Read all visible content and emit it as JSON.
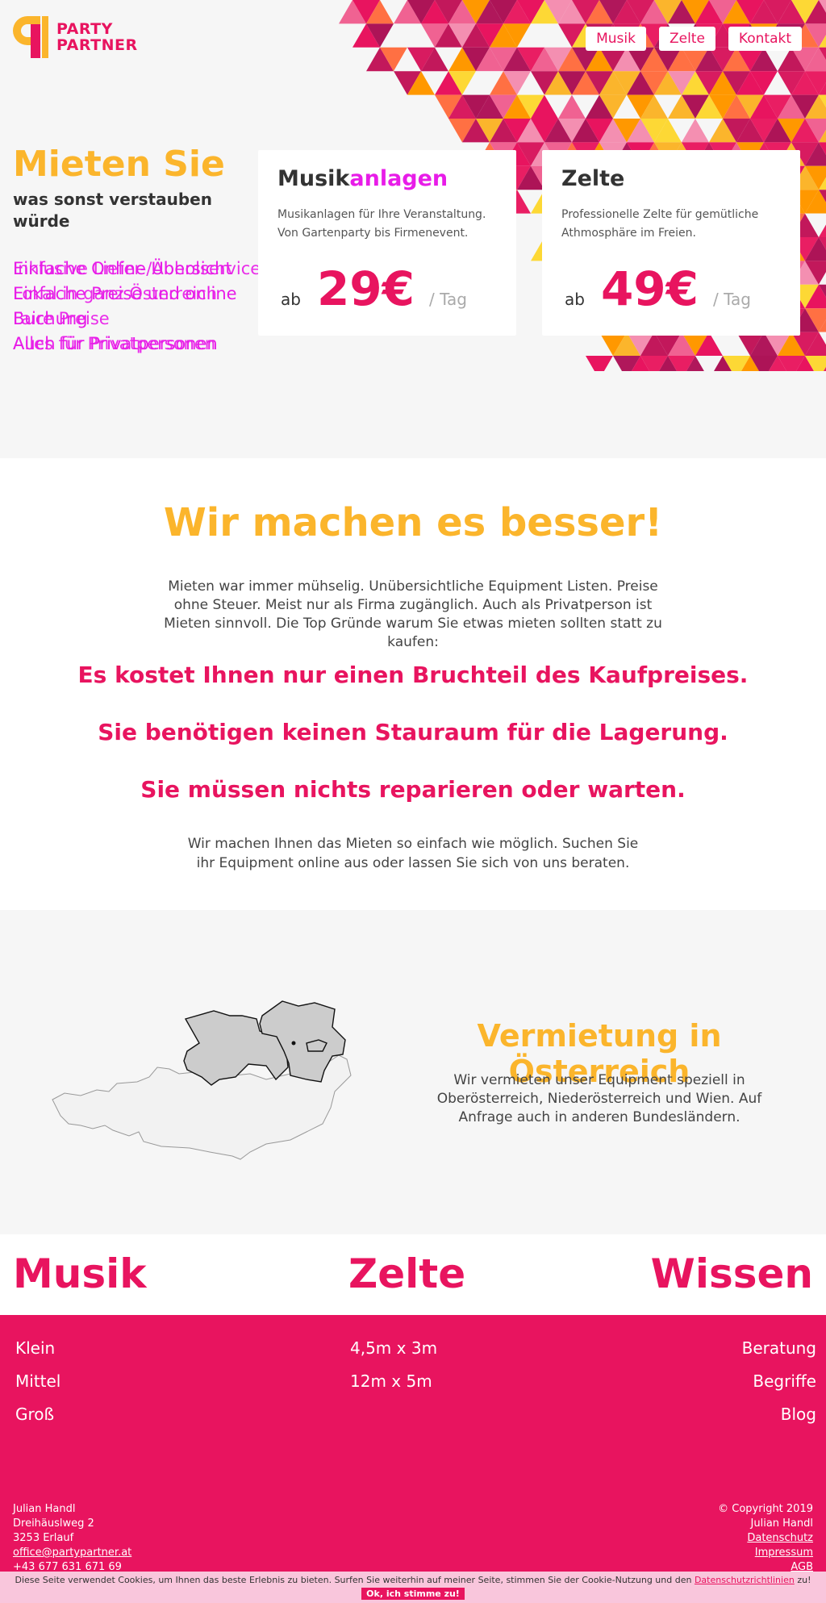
{
  "brand": {
    "line1": "PARTY",
    "line2": "PARTNER",
    "color_primary": "#e8145f",
    "color_accent": "#fbb52c",
    "color_highlight": "#e81ce8"
  },
  "nav": {
    "items": [
      "Musik",
      "Zelte",
      "Kontakt"
    ]
  },
  "hero": {
    "title": "Mieten Sie",
    "subtitle": "was sonst verstauben würde",
    "overlap_a": [
      "Einfache Online Übersicht",
      "Einfache Preise und online",
      "Buchung",
      "Auch für Privatpersonen"
    ],
    "overlap_b": [
      "Inklusive Liefer-/Abholservice",
      "Lokal in ganz Österreich",
      "Faire Preise",
      "Alles für Privatpersonen"
    ]
  },
  "cards": [
    {
      "title_a": "Musik",
      "title_b": "anlagen",
      "desc": "Musikanlagen für Ihre Veranstaltung. Von Gartenparty bis Firmenevent.",
      "price_prefix": "ab",
      "price": "29€",
      "price_unit": "/ Tag"
    },
    {
      "title_a": "Zelte",
      "title_b": "",
      "desc": "Professionelle Zelte für gemütliche Athmosphäre im Freien.",
      "price_prefix": "ab",
      "price": "49€",
      "price_unit": "/ Tag"
    }
  ],
  "besser": {
    "title": "Wir machen es besser!",
    "intro": "Mieten war immer mühselig. Unübersichtliche Equipment Listen. Preise ohne Steuer. Meist nur als Firma zugänglich. Auch als Privatperson ist Mieten sinnvoll. Die Top Gründe warum Sie etwas mieten sollten statt zu kaufen:",
    "reasons": [
      "Es kostet Ihnen nur einen Bruchteil des Kaufpreises.",
      "Sie benötigen keinen Stauraum für die Lagerung.",
      "Sie müssen nichts reparieren oder warten."
    ],
    "outro": "Wir machen Ihnen das Mieten so einfach wie möglich. Suchen Sie ihr Equipment online aus oder lassen Sie sich von uns beraten."
  },
  "austria": {
    "title": "Vermietung in Österreich",
    "text": "Wir vermieten unser Equipment speziell in Oberösterreich, Niederösterreich und Wien. Auf Anfrage auch in anderen Bundesländern."
  },
  "categories": {
    "musik": {
      "title": "Musik",
      "items": [
        "Klein",
        "Mittel",
        "Groß"
      ]
    },
    "zelte": {
      "title": "Zelte",
      "items": [
        "4,5m x 3m",
        "12m x 5m"
      ]
    },
    "wissen": {
      "title": "Wissen",
      "items": [
        "Beratung",
        "Begriffe",
        "Blog"
      ]
    }
  },
  "footer": {
    "contact": [
      "Julian Handl",
      "Dreihäuslweg 2",
      "3253 Erlauf"
    ],
    "email": "office@partypartner.at",
    "phone": "+43 677 631 671 69",
    "copyright": "© Copyright 2019",
    "owner": "Julian Handl",
    "links": [
      "Datenschutz",
      "Impressum",
      "AGB"
    ]
  },
  "cookie": {
    "text": "Diese Seite verwendet Cookies, um Ihnen das beste Erlebnis zu bieten. Surfen Sie weiterhin auf meiner Seite, stimmen Sie der Cookie-Nutzung und den",
    "link": "Datenschutzrichtlinien",
    "suffix": "zu!",
    "button": "Ok, ich stimme zu!"
  }
}
